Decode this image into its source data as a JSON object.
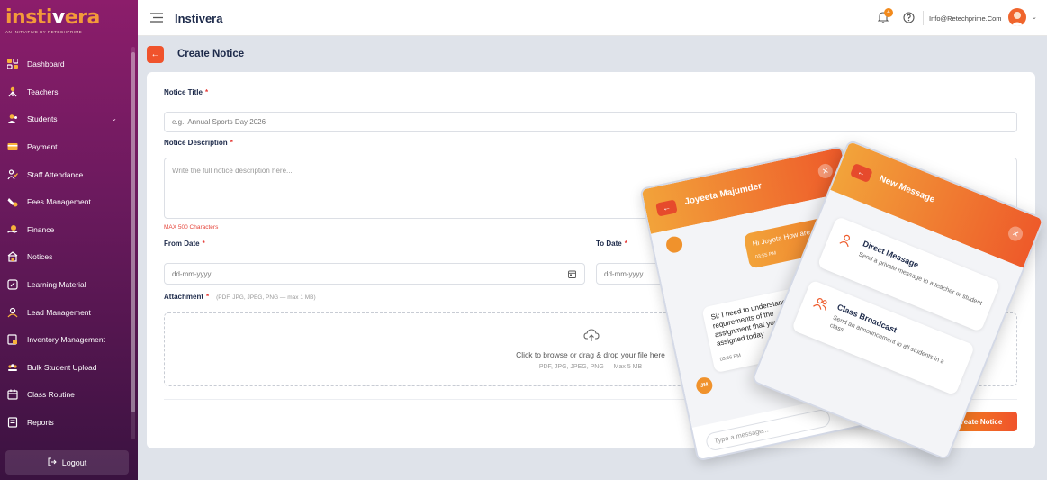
{
  "app": {
    "logo_prefix": "insti",
    "logo_v": "v",
    "logo_suffix": "era",
    "logo_tagline": "AN INITIATIVE BY RETECHPRIME",
    "brand_title": "Instivera"
  },
  "sidebar": {
    "items": [
      {
        "label": "Dashboard",
        "icon": "dashboard-icon"
      },
      {
        "label": "Teachers",
        "icon": "teacher-icon"
      },
      {
        "label": "Students",
        "icon": "students-icon"
      },
      {
        "label": "Payment",
        "icon": "payment-icon"
      },
      {
        "label": "Staff Attendance",
        "icon": "attendance-icon"
      },
      {
        "label": "Fees Management",
        "icon": "fees-icon"
      },
      {
        "label": "Finance",
        "icon": "finance-icon"
      },
      {
        "label": "Notices",
        "icon": "notices-icon"
      },
      {
        "label": "Learning Material",
        "icon": "learning-icon"
      },
      {
        "label": "Lead Management",
        "icon": "lead-icon"
      },
      {
        "label": "Inventory Management",
        "icon": "inventory-icon"
      },
      {
        "label": "Bulk Student Upload",
        "icon": "bulk-upload-icon"
      },
      {
        "label": "Class Routine",
        "icon": "routine-icon"
      },
      {
        "label": "Reports",
        "icon": "reports-icon"
      }
    ],
    "logout_label": "Logout"
  },
  "topbar": {
    "notification_count": "4",
    "email": "Info@Retechprime.Com"
  },
  "page": {
    "title": "Create Notice",
    "notice_title_label": "Notice Title",
    "notice_title_placeholder": "e.g., Annual Sports Day 2026",
    "desc_label": "Notice Description",
    "desc_placeholder": "Write the full notice description here...",
    "max_chars": "MAX 500 Characters",
    "from_date_label": "From Date",
    "to_date_label": "To Date",
    "date_placeholder": "dd-mm-yyyy",
    "attachment_label": "Attachment",
    "attachment_hint": "(PDF, JPG, JPEG, PNG — max 1 MB)",
    "drop_text": "Click to browse or drag & drop your file here",
    "drop_subtext": "PDF, JPG, JPEG, PNG — Max 5 MB",
    "required_mark": "*",
    "submit_label": "Create Notice"
  },
  "chat_window": {
    "contact_name": "Joyeeta Majumder",
    "outgoing_message": "Hi Joyeta How are you",
    "outgoing_time": "03:55 PM",
    "incoming_message": "Sir I need to understand the requirements of the assignment that you assigned today",
    "incoming_time": "03:56 PM",
    "avatar_initials": "JM",
    "input_placeholder": "Type a message..."
  },
  "new_message_window": {
    "title": "New Message",
    "options": [
      {
        "title": "Direct Message",
        "desc": "Send a private message to a teacher or student"
      },
      {
        "title": "Class Broadcast",
        "desc": "Send an announcement to all students in a class"
      }
    ]
  },
  "colors": {
    "accent": "#f0532c",
    "accent_light": "#f2a33a",
    "sidebar_top": "#8c1d6b",
    "sidebar_bottom": "#3a1240",
    "required": "#e53935"
  }
}
